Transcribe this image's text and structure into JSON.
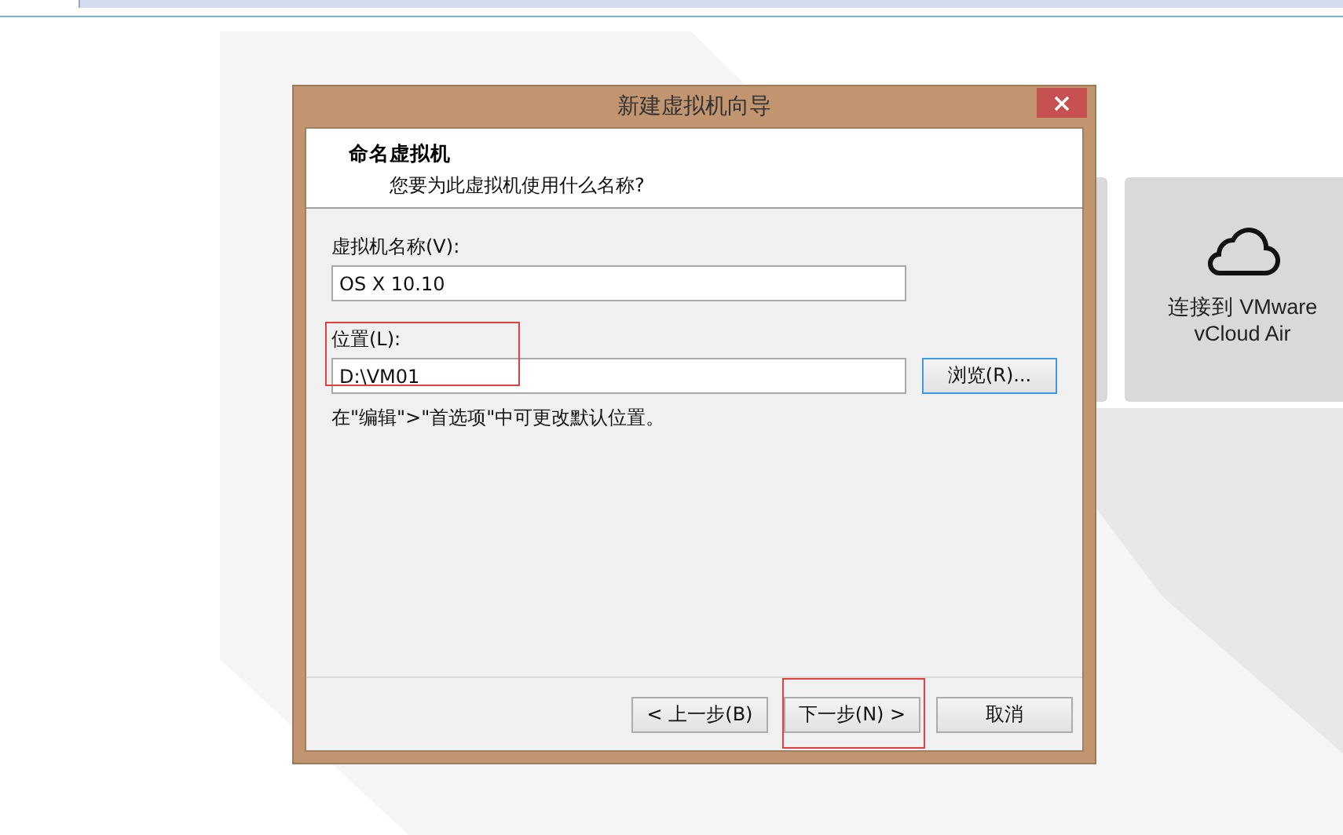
{
  "tiles": [
    {
      "kind": "hidden"
    },
    {
      "kind": "cloud",
      "label": "连接到 VMware vCloud Air"
    }
  ],
  "dialog": {
    "title": "新建虚拟机向导",
    "header": {
      "title": "命名虚拟机",
      "subtitle": "您要为此虚拟机使用什么名称?"
    },
    "name_field": {
      "label": "虚拟机名称(V):",
      "value": "OS X 10.10"
    },
    "location_field": {
      "label": "位置(L):",
      "value": "D:\\VM01",
      "highlighted": true
    },
    "browse_button": {
      "label": "浏览(R)...",
      "focused": true
    },
    "hint": "在\"编辑\">\"首选项\"中可更改默认位置。",
    "buttons": [
      {
        "label": "< 上一步(B)",
        "highlighted": false
      },
      {
        "label": "下一步(N) >",
        "highlighted": true
      },
      {
        "label": "取消",
        "highlighted": false
      }
    ]
  }
}
